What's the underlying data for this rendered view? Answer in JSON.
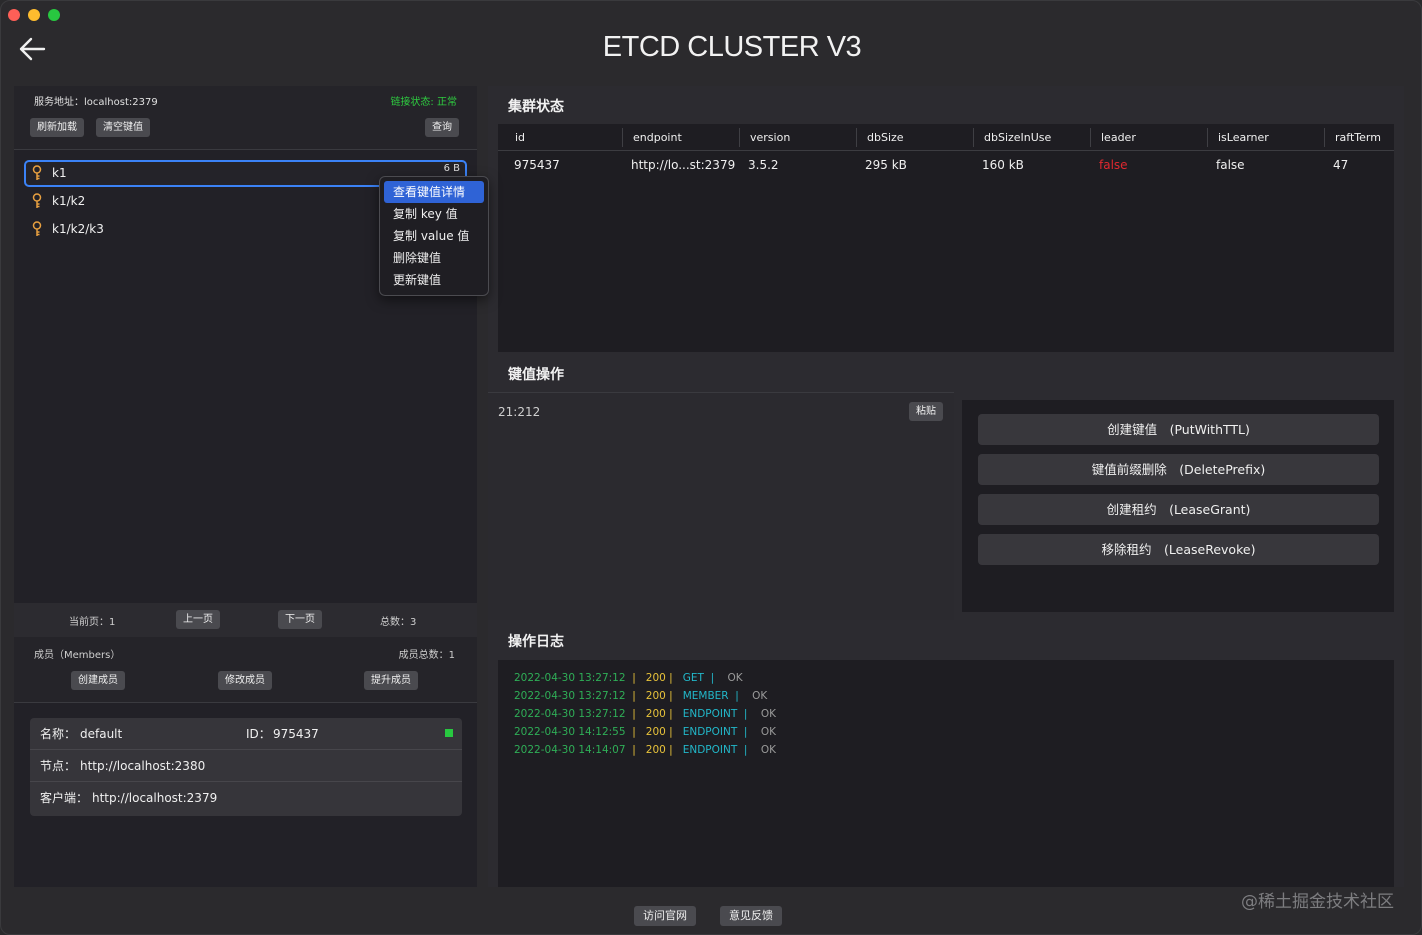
{
  "app": {
    "title": "ETCD CLUSTER V3"
  },
  "server": {
    "address": "服务地址：localhost:2379",
    "status": "链接状态: 正常",
    "refresh_label": "刷新加载",
    "clear_label": "清空键值",
    "query_label": "查询"
  },
  "keys": [
    {
      "name": "k1",
      "size": "6 B"
    },
    {
      "name": "k1/k2"
    },
    {
      "name": "k1/k2/k3"
    }
  ],
  "context_menu": {
    "items": [
      "查看键值详情",
      "复制 key 值",
      "复制 value 值",
      "删除键值",
      "更新键值"
    ]
  },
  "pager": {
    "current": "当前页：1",
    "prev_label": "上一页",
    "next_label": "下一页",
    "total": "总数：3"
  },
  "members": {
    "title": "成员（Members）",
    "total": "成员总数：1",
    "create_label": "创建成员",
    "modify_label": "修改成员",
    "promote_label": "提升成员",
    "card": {
      "name_label": "名称：",
      "name": "default",
      "id_label": "ID：",
      "id": "975437",
      "peer_label": "节点：",
      "peer": "http://localhost:2380",
      "client_label": "客户端：",
      "client": "http://localhost:2379",
      "status_color": "#28c840"
    }
  },
  "cluster": {
    "title": "集群状态",
    "columns": [
      "id",
      "endpoint",
      "version",
      "dbSize",
      "dbSizeInUse",
      "leader",
      "isLearner",
      "raftTerm"
    ],
    "rows": [
      [
        "975437",
        "http://lo...st:2379",
        "3.5.2",
        "295 kB",
        "160 kB",
        "false",
        "false",
        "47"
      ]
    ],
    "leader_false_color": "#e0282f"
  },
  "kv": {
    "title": "键值操作",
    "editor_text": "21:212",
    "paste_label": "粘贴",
    "actions": [
      "创建键值　(PutWithTTL)",
      "键值前缀删除　(DeletePrefix)",
      "创建租约　(LeaseGrant)",
      "移除租约　(LeaseRevoke)"
    ]
  },
  "log": {
    "title": "操作日志",
    "entries": [
      {
        "time": "2022-04-30 13:27:12",
        "code": "200",
        "type": "GET",
        "result": "OK"
      },
      {
        "time": "2022-04-30 13:27:12",
        "code": "200",
        "type": "MEMBER",
        "result": "OK"
      },
      {
        "time": "2022-04-30 13:27:12",
        "code": "200",
        "type": "ENDPOINT",
        "result": "OK"
      },
      {
        "time": "2022-04-30 14:12:55",
        "code": "200",
        "type": "ENDPOINT",
        "result": "OK"
      },
      {
        "time": "2022-04-30 14:14:07",
        "code": "200",
        "type": "ENDPOINT",
        "result": "OK"
      }
    ]
  },
  "footer": {
    "website_label": "访问官网",
    "feedback_label": "意见反馈",
    "watermark": "@稀土掘金技术社区"
  },
  "colors": {
    "accent_blue": "#2f63d6",
    "status_green": "#2ecc40"
  }
}
